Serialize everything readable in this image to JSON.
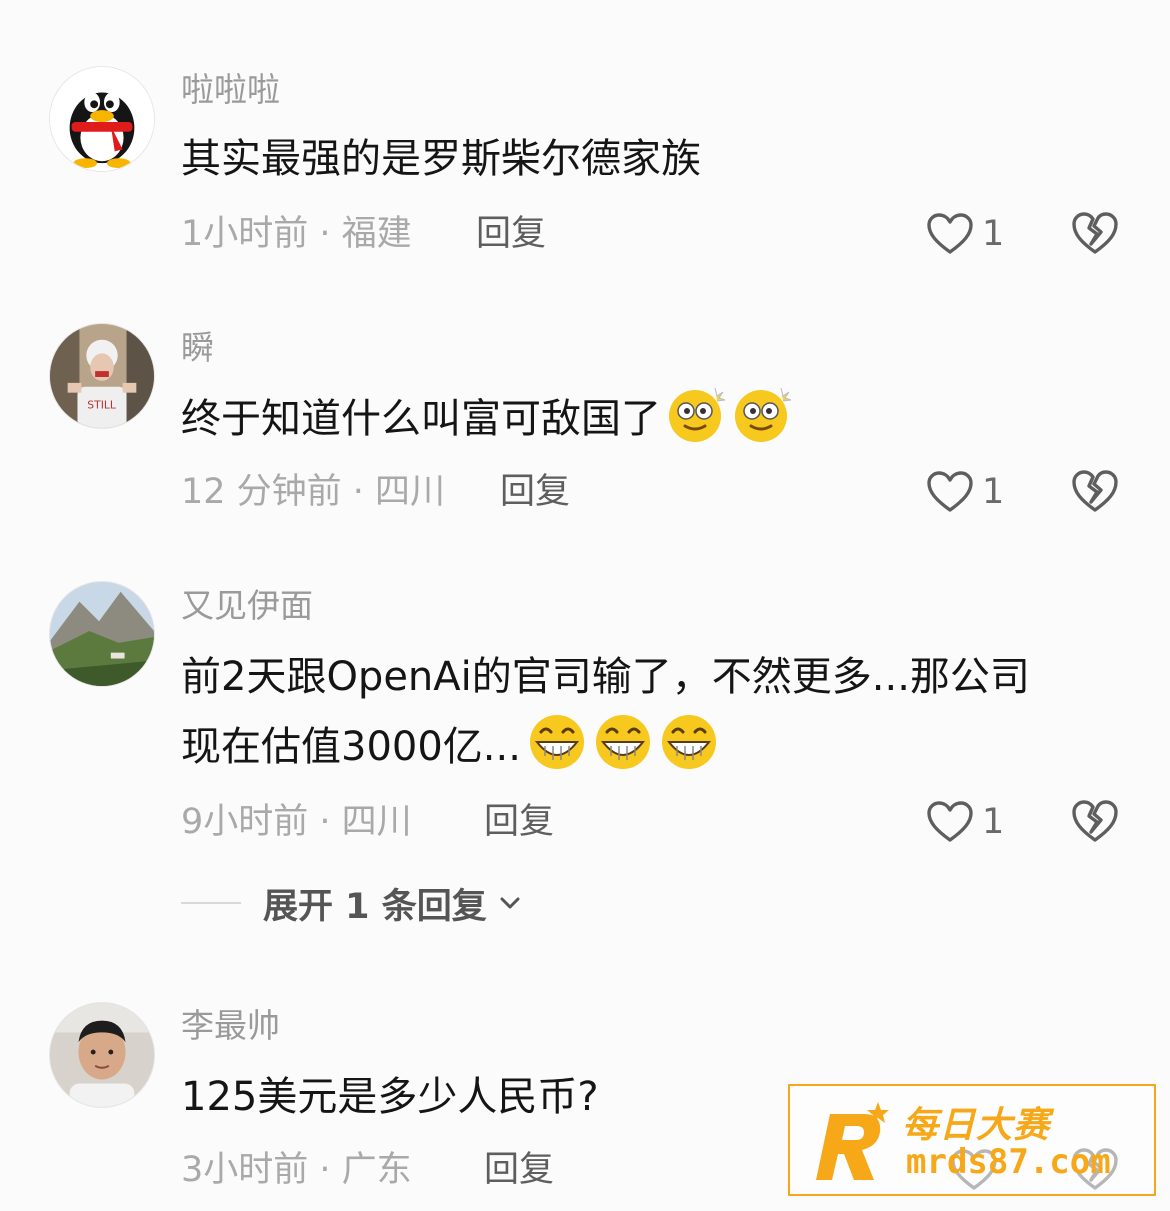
{
  "comments": [
    {
      "username": "啦啦啦",
      "text": "其实最强的是罗斯柴尔德家族",
      "time": "1小时前 · 福建",
      "reply_label": "回复",
      "likes": "1",
      "avatar": "penguin-avatar"
    },
    {
      "username": "瞬",
      "text": "终于知道什么叫富可敌国了",
      "time": "12 分钟前 · 四川",
      "reply_label": "回复",
      "likes": "1",
      "emojis": [
        "dizzy-face-icon",
        "dizzy-face-icon"
      ],
      "avatar": "person-photo-avatar"
    },
    {
      "username": "又见伊面",
      "text_line1": "前2天跟OpenAi的官司输了，不然更多...那公司",
      "text_line2": "现在估值3000亿...",
      "time": "9小时前 · 四川",
      "reply_label": "回复",
      "likes": "1",
      "emojis": [
        "grin-face-icon",
        "grin-face-icon",
        "grin-face-icon"
      ],
      "avatar": "mountain-photo-avatar"
    },
    {
      "username": "李最帅",
      "text": "125美元是多少人民币?",
      "time": "3小时前 · 广东",
      "reply_label": "回复",
      "avatar": "selfie-photo-avatar"
    }
  ],
  "expand_replies": {
    "label": "展开 1 条回复"
  },
  "watermark": {
    "title": "每日大赛",
    "url": "mrds87.com"
  },
  "colors": {
    "username": "#9a9a9a",
    "meta": "#a9a9a9",
    "accent": "#f6a818"
  }
}
